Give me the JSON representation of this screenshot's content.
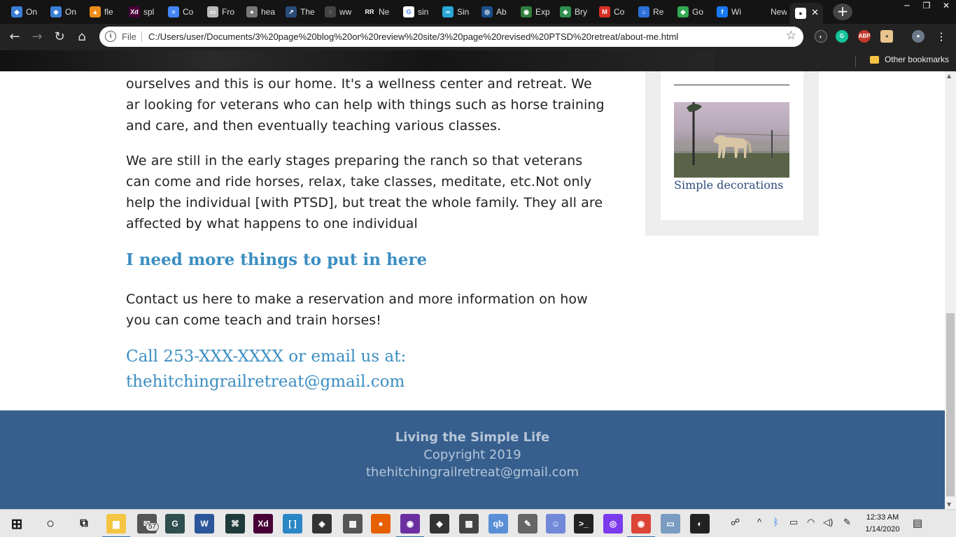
{
  "browser": {
    "tabs": [
      {
        "title": "On",
        "fav": "◆",
        "color": "#3b7ed6"
      },
      {
        "title": "On",
        "fav": "◆",
        "color": "#3b7ed6"
      },
      {
        "title": "fle",
        "fav": "▲",
        "color": "#f08c1c"
      },
      {
        "title": "spl",
        "fav": "Xd",
        "color": "#470137"
      },
      {
        "title": "Co",
        "fav": "≡",
        "color": "#4285f4"
      },
      {
        "title": "Fro",
        "fav": "▭",
        "color": "#bbbbbb"
      },
      {
        "title": "hea",
        "fav": "●",
        "color": "#777777"
      },
      {
        "title": "The",
        "fav": "↗",
        "color": "#2a4a7a"
      },
      {
        "title": "ww",
        "fav": "◌",
        "color": "#444444"
      },
      {
        "title": "Ne",
        "fav": "RR",
        "color": "#111111"
      },
      {
        "title": "sin",
        "fav": "G",
        "color": "#ffffff"
      },
      {
        "title": "Sin",
        "fav": "∞",
        "color": "#2aa7d8"
      },
      {
        "title": "Ab",
        "fav": "◎",
        "color": "#1b4f8b"
      },
      {
        "title": "Exp",
        "fav": "◉",
        "color": "#2f7f3f"
      },
      {
        "title": "Bry",
        "fav": "◆",
        "color": "#2f8f4f"
      },
      {
        "title": "Co",
        "fav": "M",
        "color": "#d93025"
      },
      {
        "title": "Re",
        "fav": "⌂",
        "color": "#2b6fd8"
      },
      {
        "title": "Go",
        "fav": "◆",
        "color": "#34a853"
      },
      {
        "title": "Wi",
        "fav": "f",
        "color": "#1877f2"
      },
      {
        "title": "New Ta",
        "fav": "",
        "color": "#141414"
      }
    ],
    "active_tab_favicon": "●",
    "close_icon": "✕",
    "new_tab_icon": "+",
    "window_controls": [
      "─",
      "❐",
      "✕"
    ],
    "address": {
      "scheme_label": "File",
      "url": "C:/Users/user/Documents/3%20page%20blog%20or%20review%20site/3%20page%20revised%20PTSD%20retreat/about-me.html"
    },
    "bookmarks": {
      "other_label": "Other bookmarks"
    }
  },
  "page": {
    "para1": "ourselves and this is our home. It's a wellness center and retreat. We ar looking for veterans who can help with things such as horse training and care, and then eventually teaching various classes.",
    "para2": "We are still in the early stages preparing the ranch so that veterans can come and ride horses, relax, take classes, meditate, etc.Not only help the individual [with PTSD], but treat the whole family. They all are affected by what happens to one individual",
    "heading_more": "I need more things to put in here",
    "para3": "Contact us here to make a reservation and more information on how you can come teach and train horses!",
    "call_line": "Call 253-XXX-XXXX or email us at:",
    "call_email": "thehitchingrailretreat@gmail.com",
    "sidebar": {
      "caption": "Simple decorations"
    },
    "footer": {
      "title": "Living the Simple Life",
      "copyright": "Copyright 2019",
      "email": "thehitchingrailretreat@gmail.com"
    },
    "colors": {
      "link": "#3b8ec2",
      "footer_bg": "#365f8e",
      "caption": "#2d4c7c"
    }
  },
  "taskbar": {
    "badge_count": "57",
    "time": "12:33 AM",
    "date": "1/14/2020",
    "apps": [
      {
        "name": "file-explorer",
        "label": "▆",
        "color": "#f4c542"
      },
      {
        "name": "mail",
        "label": "✉",
        "color": "#555555"
      },
      {
        "name": "greenshot",
        "label": "G",
        "color": "#2f4f4f"
      },
      {
        "name": "word",
        "label": "W",
        "color": "#2b579a"
      },
      {
        "name": "vscode-like",
        "label": "⌘",
        "color": "#1e3a3a"
      },
      {
        "name": "adobe-xd",
        "label": "Xd",
        "color": "#470137"
      },
      {
        "name": "brackets",
        "label": "[ ]",
        "color": "#2b87c6"
      },
      {
        "name": "color-app",
        "label": "◈",
        "color": "#333333"
      },
      {
        "name": "onenote-like",
        "label": "▦",
        "color": "#555555"
      },
      {
        "name": "firefox",
        "label": "●",
        "color": "#e66000"
      },
      {
        "name": "chrome-active",
        "label": "◉",
        "color": "#6b2fa0"
      },
      {
        "name": "inkscape",
        "label": "◆",
        "color": "#333333"
      },
      {
        "name": "calculator",
        "label": "▦",
        "color": "#444444"
      },
      {
        "name": "qbittorrent",
        "label": "qb",
        "color": "#5a8fd8"
      },
      {
        "name": "gimp",
        "label": "✎",
        "color": "#666666"
      },
      {
        "name": "discord",
        "label": "☺",
        "color": "#7289da"
      },
      {
        "name": "terminal",
        "label": ">_",
        "color": "#222222"
      },
      {
        "name": "podcast",
        "label": "◎",
        "color": "#7c3aed"
      },
      {
        "name": "chrome",
        "label": "◉",
        "color": "#db4437"
      },
      {
        "name": "image-viewer",
        "label": "▭",
        "color": "#7a9cc0"
      },
      {
        "name": "steam-like",
        "label": "◐",
        "color": "#222222"
      }
    ]
  }
}
